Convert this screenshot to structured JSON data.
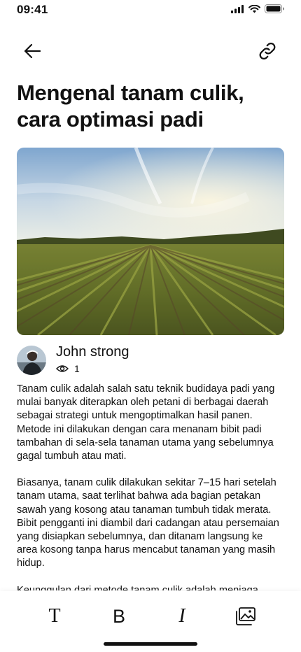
{
  "status_bar": {
    "time": "09:41"
  },
  "header": {
    "back_icon": "arrow-left-icon",
    "link_icon": "link-icon"
  },
  "article": {
    "title": "Mengenal tanam culik, cara optimasi padi",
    "hero_image": "rice-field-photo",
    "author": {
      "name": "John strong",
      "views": "1"
    },
    "paragraphs": [
      "Tanam culik adalah salah satu teknik budidaya padi yang mulai banyak diterapkan oleh petani di berbagai daerah sebagai strategi untuk mengoptimalkan hasil panen. Metode ini dilakukan dengan cara menanam bibit padi tambahan di sela-sela tanaman utama yang sebelumnya gagal tumbuh atau mati.",
      "Biasanya, tanam culik dilakukan sekitar 7–15 hari setelah tanam utama, saat terlihat bahwa ada bagian petakan sawah yang kosong atau tanaman tumbuh tidak merata. Bibit pengganti ini diambil dari cadangan atau persemaian yang disiapkan sebelumnya, dan ditanam langsung ke area kosong tanpa harus mencabut tanaman yang masih hidup.",
      "Keunggulan dari metode tanam culik adalah menjaga"
    ]
  },
  "toolbar": {
    "text_label": "T",
    "bold_label": "B",
    "italic_label": "I",
    "image_icon": "image-gallery-icon"
  }
}
